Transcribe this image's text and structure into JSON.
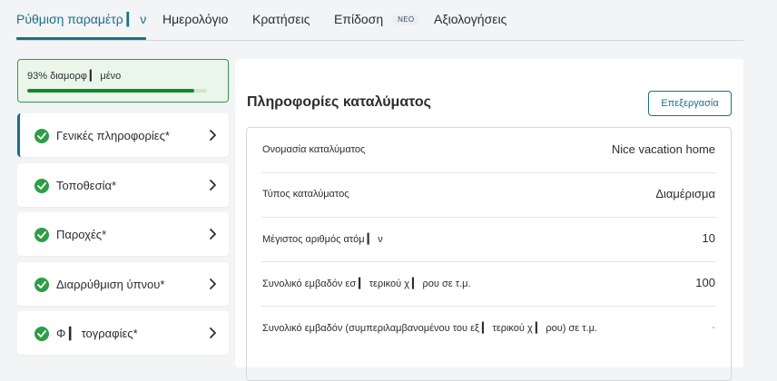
{
  "tabs": [
    {
      "label": "Ρύθμιση παραμέτρ ▎ ν",
      "active": true
    },
    {
      "label": "Ημερολόγιο"
    },
    {
      "label": "Κρατήσεις"
    },
    {
      "label": "Επίδοση",
      "badge": "ΝΕΟ"
    },
    {
      "label": "Αξιολογήσεις"
    }
  ],
  "progress": {
    "text": "93% διαμορφ ▎ μένο",
    "percent": 93,
    "color": "#118a2e"
  },
  "sidebar": {
    "items": [
      {
        "label": "Γενικές πληροφορίες*",
        "icon": "check-circle-icon",
        "active": true
      },
      {
        "label": "Τοποθεσία*",
        "icon": "check-circle-icon"
      },
      {
        "label": "Παροχές*",
        "icon": "check-circle-icon"
      },
      {
        "label": "Διαρρύθμιση ύπνου*",
        "icon": "check-circle-icon"
      },
      {
        "label": "Φ ▎ τογραφίες*",
        "icon": "check-circle-icon"
      }
    ]
  },
  "main": {
    "title": "Πληροφορίες καταλύματος",
    "edit_label": "Επεξεργασία",
    "rows": [
      {
        "label": "Ονομασία καταλύματος",
        "value": "Nice vacation home"
      },
      {
        "label": "Τύπος καταλύματος",
        "value": "Διαμέρισμα"
      },
      {
        "label": "Μέγιστος αριθμός ατόμ ▎ ν",
        "value": "10"
      },
      {
        "label": "Συνολικό εμβαδόν εσ ▎ τερικού χ ▎ ρου σε τ.μ.",
        "value": "100"
      },
      {
        "label": "Συνολικό εμβαδόν (συμπεριλαμβανομένου του εξ ▎ τερικού χ ▎ ρου) σε τ.μ.",
        "value": "-"
      }
    ]
  },
  "colors": {
    "accent": "#1a6f8a",
    "success": "#2e9d45",
    "background": "#f3f4f5"
  }
}
